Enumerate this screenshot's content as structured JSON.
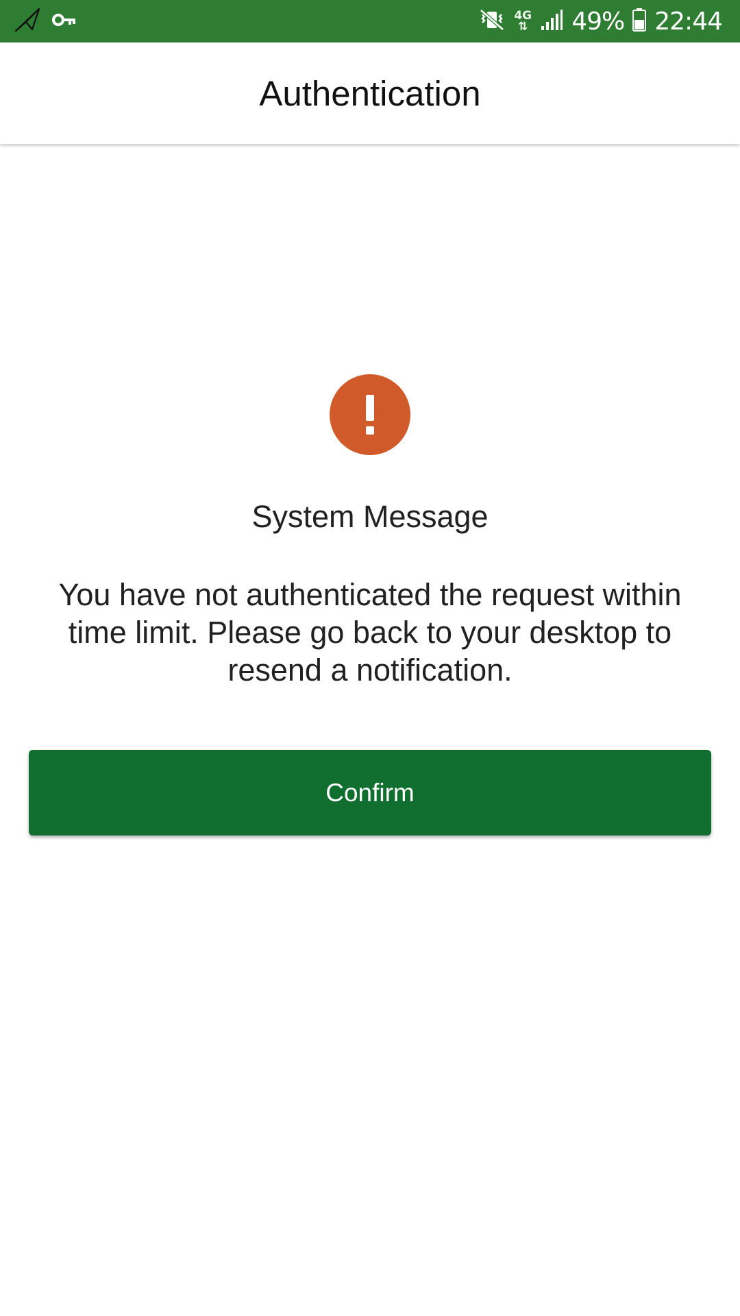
{
  "status_bar": {
    "left_icons": [
      "send-icon",
      "vpn-key-icon"
    ],
    "network_type": "4G",
    "battery_percent": "49%",
    "time": "22:44",
    "right_icons": [
      "vibrate-mute-icon",
      "network-4g-icon",
      "signal-icon",
      "battery-icon"
    ],
    "background_color": "#2e7d32"
  },
  "app_bar": {
    "title": "Authentication"
  },
  "message": {
    "icon": "alert-exclamation-icon",
    "icon_color": "#d05a2a",
    "title": "System Message",
    "body": "You have not authenticated the request within time limit. Please go back to your desktop to resend a notification."
  },
  "actions": {
    "confirm_label": "Confirm",
    "confirm_color": "#106f2f"
  }
}
